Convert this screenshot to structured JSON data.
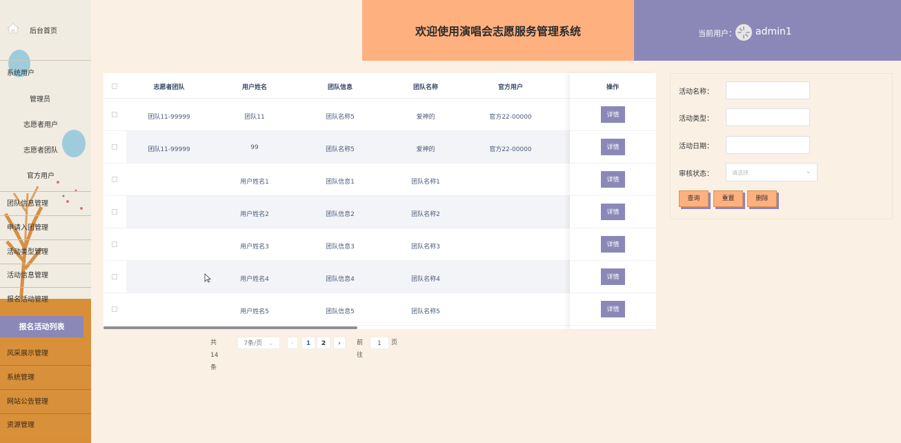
{
  "header": {
    "title": "欢迎使用演唱会志愿服务管理系统",
    "current_user_label": "当前用户：",
    "username": "admin1"
  },
  "sidebar": {
    "home": "后台首页",
    "items": [
      {
        "label": "系统用户"
      },
      {
        "label": "管理员"
      },
      {
        "label": "志愿者用户"
      },
      {
        "label": "志愿者团队"
      },
      {
        "label": "官方用户"
      },
      {
        "label": "团队信息管理"
      },
      {
        "label": "申请入团管理"
      },
      {
        "label": "活动类型管理"
      },
      {
        "label": "活动信息管理"
      },
      {
        "label": "报名活动管理"
      },
      {
        "label": "报名活动列表"
      },
      {
        "label": "风采展示管理"
      },
      {
        "label": "系统管理"
      },
      {
        "label": "网站公告管理"
      },
      {
        "label": "资源管理"
      }
    ]
  },
  "table": {
    "columns": [
      "志愿者团队",
      "用户姓名",
      "团队信息",
      "团队名称",
      "官方用户",
      "操作"
    ],
    "rows": [
      [
        "团队11-99999",
        "团队11",
        "团队名称5",
        "爱神的",
        "官方22-00000"
      ],
      [
        "团队11-99999",
        "99",
        "团队名称5",
        "爱神的",
        "官方22-00000"
      ],
      [
        "",
        "用户姓名1",
        "团队信息1",
        "团队名称1",
        ""
      ],
      [
        "",
        "用户姓名2",
        "团队信息2",
        "团队名称2",
        ""
      ],
      [
        "",
        "用户姓名3",
        "团队信息3",
        "团队名称3",
        ""
      ],
      [
        "",
        "用户姓名4",
        "团队信息4",
        "团队名称4",
        ""
      ],
      [
        "",
        "用户姓名5",
        "团队信息5",
        "团队名称5",
        ""
      ]
    ],
    "detail_label": "详情"
  },
  "pager": {
    "total": "共 14 条",
    "page_size": "7条/页",
    "prev": "‹",
    "page1": "1",
    "page2": "2",
    "next": "›",
    "goto_label": "前往",
    "goto_value": "1",
    "page_unit": "页"
  },
  "filter": {
    "activity_name_label": "活动名称：",
    "activity_type_label": "活动类型：",
    "activity_date_label": "活动日期：",
    "review_status_label": "审核状态：",
    "review_status_placeholder": "请选择",
    "query_button": "查询",
    "reset_button": "重置",
    "delete_button": "删除"
  },
  "colors": {
    "accent_purple": "#8b88b8",
    "accent_orange": "#ffb07f",
    "sidebar_orange": "#d98f38",
    "background": "#faf1e4"
  }
}
